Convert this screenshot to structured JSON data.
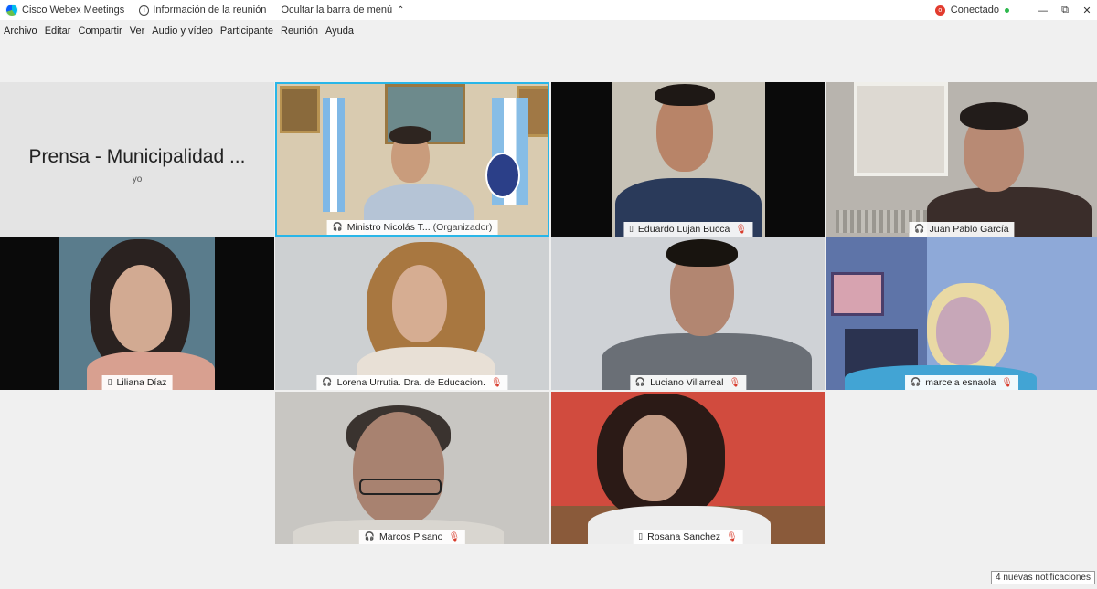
{
  "titlebar": {
    "app_name": "Cisco Webex Meetings",
    "meeting_info": "Información de la reunión",
    "hide_menu": "Ocultar la barra de menú",
    "status": "Conectado",
    "minimize": "—",
    "restore": "⧉",
    "close": "✕"
  },
  "menu": [
    "Archivo",
    "Editar",
    "Compartir",
    "Ver",
    "Audio y vídeo",
    "Participante",
    "Reunión",
    "Ayuda"
  ],
  "self_tile": {
    "name": "Prensa - Municipalidad ...",
    "sub": "yo"
  },
  "participants": [
    {
      "name": "Ministro Nicolás T...",
      "role": "(Organizador)",
      "device": "headset",
      "muted": false
    },
    {
      "name": "Eduardo Lujan Bucca",
      "device": "phone",
      "muted": true
    },
    {
      "name": "Juan Pablo García",
      "device": "headset",
      "muted": false
    },
    {
      "name": "Liliana Díaz",
      "device": "phone",
      "muted": false
    },
    {
      "name": "Lorena Urrutia. Dra. de Educacion.",
      "device": "headset",
      "muted": true
    },
    {
      "name": "Luciano Villarreal",
      "device": "headset",
      "muted": true
    },
    {
      "name": "marcela esnaola",
      "device": "headset",
      "muted": true
    },
    {
      "name": "Marcos Pisano",
      "device": "headset",
      "muted": true
    },
    {
      "name": "Rosana Sanchez",
      "device": "phone",
      "muted": true
    }
  ],
  "notification": "4 nuevas notificaciones",
  "colors": {
    "active_border": "#29b6e8",
    "muted": "#d83a2a"
  }
}
